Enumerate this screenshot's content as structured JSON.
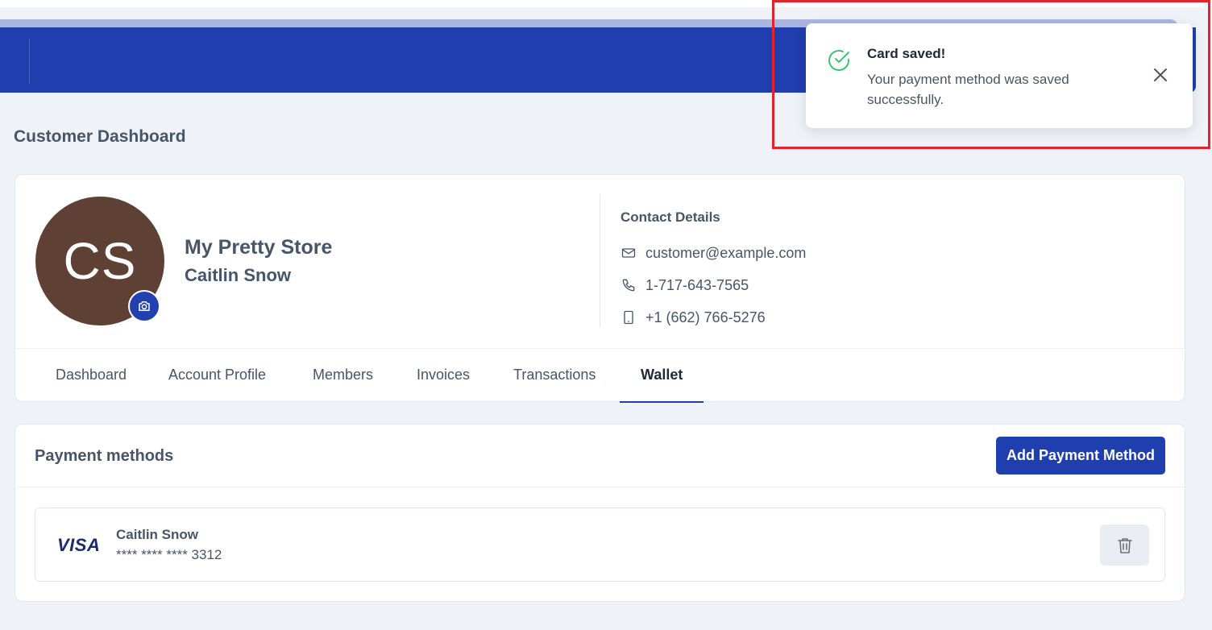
{
  "page": {
    "title": "Customer Dashboard"
  },
  "profile": {
    "initials": "CS",
    "avatar_color": "#5e4034",
    "store_name": "My Pretty Store",
    "customer_name": "Caitlin Snow",
    "camera_icon": "camera-icon"
  },
  "contact": {
    "title": "Contact Details",
    "email": "customer@example.com",
    "phone": "1-717-643-7565",
    "mobile": "+1 (662) 766-5276"
  },
  "tabs": [
    {
      "label": "Dashboard",
      "active": false
    },
    {
      "label": "Account Profile",
      "active": false
    },
    {
      "label": "Members",
      "active": false
    },
    {
      "label": "Invoices",
      "active": false
    },
    {
      "label": "Transactions",
      "active": false
    },
    {
      "label": "Wallet",
      "active": true
    }
  ],
  "payment": {
    "title": "Payment methods",
    "add_label": "Add Payment Method",
    "cards": [
      {
        "brand": "VISA",
        "holder": "Caitlin Snow",
        "number": "**** **** **** 3312"
      }
    ]
  },
  "toast": {
    "title": "Card saved!",
    "message": "Your payment method was saved successfully.",
    "status_color": "#22c55e"
  },
  "colors": {
    "brand": "#1f3fae",
    "background": "#eff2f7",
    "highlight": "#e3232b"
  }
}
